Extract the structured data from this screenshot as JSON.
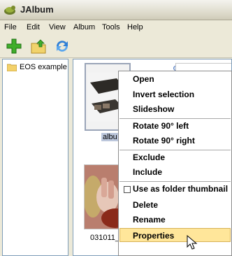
{
  "window": {
    "title": "JAlbum"
  },
  "menu": [
    "File",
    "Edit",
    "View",
    "Album",
    "Tools",
    "Help"
  ],
  "toolbar": {
    "icons": [
      "add-icon",
      "folder-up-icon",
      "refresh-icon"
    ]
  },
  "tree": {
    "item": "EOS example"
  },
  "thumbnails": {
    "caption1": "albu",
    "caption2": "031011_"
  },
  "context_menu": {
    "items": [
      "Open",
      "Invert selection",
      "Slideshow",
      "Rotate 90° left",
      "Rotate 90° right",
      "Exclude",
      "Include",
      "Use as folder thumbnail",
      "Delete",
      "Rename",
      "Properties"
    ],
    "highlighted": "Properties"
  },
  "colors": {
    "highlight": "#ffe69a",
    "selection": "#bcc7dc"
  }
}
